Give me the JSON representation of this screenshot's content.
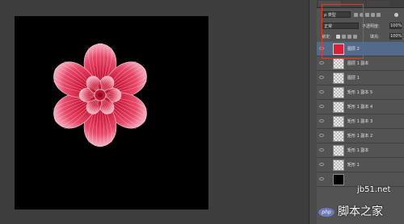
{
  "panel": {
    "filter_kind": "ρ 类型",
    "blend_mode": "正常",
    "opacity_label": "不透明度:",
    "opacity_value": "100%",
    "lock_label": "锁定:",
    "fill_label": "填充:",
    "fill_value": "100%"
  },
  "layers": [
    {
      "name": "图层 2",
      "thumb": "red",
      "selected": true
    },
    {
      "name": "图层 1 副本",
      "thumb": "transparent"
    },
    {
      "name": "图层 1",
      "thumb": "transparent"
    },
    {
      "name": "矩形 1 副本 5",
      "thumb": "transparent"
    },
    {
      "name": "矩形 1 副本 4",
      "thumb": "transparent"
    },
    {
      "name": "矩形 1 副本 3",
      "thumb": "transparent"
    },
    {
      "name": "矩形 1 副本 2",
      "thumb": "transparent"
    },
    {
      "name": "矩形 1 副本",
      "thumb": "transparent"
    },
    {
      "name": "矩形 1",
      "thumb": "transparent"
    },
    {
      "name": "",
      "thumb": "black"
    }
  ],
  "watermark": {
    "site": "jb51.net",
    "badge": "php",
    "chinese": "脚本之家"
  },
  "colors": {
    "highlight": "#e23b2e",
    "petal": "#d01a3a",
    "layer_selected": "#546a8a"
  }
}
